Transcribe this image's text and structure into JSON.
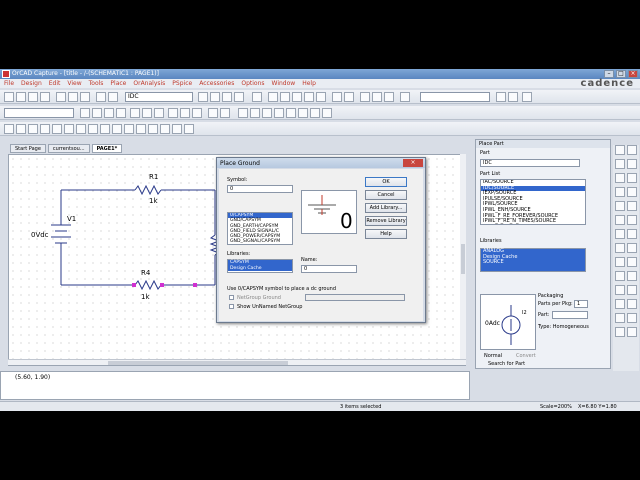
{
  "window": {
    "title": "OrCAD Capture - [title - /-(SCHEMATIC1 : PAGE1)]"
  },
  "menu": [
    "File",
    "Design",
    "Edit",
    "View",
    "Tools",
    "Place",
    "OrAnalysis",
    "PSpice",
    "Accessories",
    "Options",
    "Window",
    "Help"
  ],
  "brand": "cadence",
  "toolbar": {
    "part_combo": "IDC",
    "zoom_combo": ""
  },
  "tabs": [
    "Start Page",
    "currentsou...",
    "PAGE1*"
  ],
  "schematic": {
    "r1": {
      "name": "R1",
      "value": "1k"
    },
    "r4": {
      "name": "R4",
      "value": "1k"
    },
    "v1": {
      "name": "V1",
      "value": "0Vdc"
    }
  },
  "console": {
    "coords": "(5.60, 1.90)"
  },
  "status": {
    "selection": "3 items selected",
    "scale": "Scale=200%",
    "xy": "X=6.80  Y=1.80"
  },
  "place_part": {
    "title": "Place Part",
    "part_label": "Part",
    "part_value": "IDC",
    "part_list_label": "Part List",
    "parts": [
      "IAC/SOURCE",
      "IDC/SOURCE",
      "IEXP/SOURCE",
      "IPULSE/SOURCE",
      "IPWL/SOURCE",
      "IPWL_ENH/SOURCE",
      "IPWL_F_RE_FOREVER/SOURCE",
      "IPWL_F_RE_N_TIMES/SOURCE"
    ],
    "selected_part": "IDC/SOURCE",
    "libraries_label": "Libraries",
    "libraries": [
      "ANALOG",
      "Design Cache",
      "SOURCE"
    ],
    "packaging_label": "Packaging",
    "parts_per_pkg_label": "Parts per Pkg:",
    "parts_per_pkg": "1",
    "part_sel": "Part:",
    "type_label": "Type: Homogeneous",
    "preview_value": "0Adc",
    "preview_ref": "I2",
    "normal": "Normal",
    "convert": "Convert",
    "search": "Search for Part"
  },
  "dialog": {
    "title": "Place Ground",
    "symbol_label": "Symbol:",
    "symbol_value": "0",
    "symbols": [
      "0/CAPSYM",
      "GND/CAPSYM",
      "GND_EARTH/CAPSYM",
      "GND_FIELD SIGNAL/C",
      "GND_POWER/CAPSYM",
      "GND_SIGNAL/CAPSYM"
    ],
    "selected_symbol": "0/CAPSYM",
    "libraries_label": "Libraries:",
    "libraries": [
      "CAPSYM",
      "Design Cache"
    ],
    "name_label": "Name:",
    "name_value": "0",
    "preview_text": "0",
    "hint": "Use 0/CAPSYM symbol to place a dc ground",
    "netgroup_ground": "NetGroup Ground",
    "show_netgroup": "Show UnNamed NetGroup",
    "ok": "OK",
    "cancel": "Cancel",
    "add_library": "Add Library...",
    "remove_library": "Remove Library",
    "help": "Help"
  }
}
